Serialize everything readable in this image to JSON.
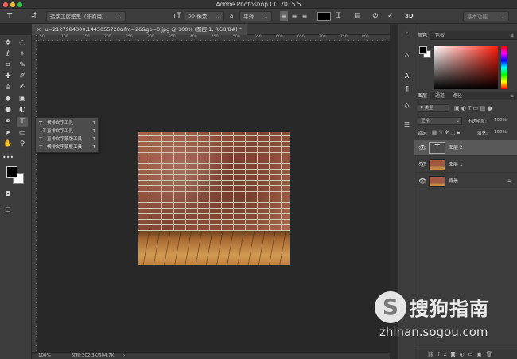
{
  "app": {
    "title": "Adobe Photoshop CC 2015.5"
  },
  "options_bar": {
    "tool_icon": "type-tool-icon",
    "orientation_icon": "text-orientation-icon",
    "font_family": "造字工房坚黑（非商用）",
    "size_icon": "font-size-icon",
    "font_size": "22 像素",
    "aa_prefix": "a",
    "aa_mode": "平滑",
    "text_color": "#000000",
    "workspace": "基本功能"
  },
  "document": {
    "tab_title": "u=2127984300,1445055728&fm=26&gp=0.jpg @ 100% (图层 1, RGB/8#) *",
    "ruler_numbers": [
      "50",
      "100",
      "150",
      "200",
      "250",
      "300",
      "350",
      "400",
      "450",
      "500",
      "550",
      "600",
      "650",
      "700",
      "750",
      "800"
    ]
  },
  "flyout": {
    "items": [
      {
        "icon": "T",
        "label": "横排文字工具",
        "shortcut": "T"
      },
      {
        "icon": "↓T",
        "label": "直排文字工具",
        "shortcut": "T"
      },
      {
        "icon": "T",
        "label": "直排文字蒙版工具",
        "shortcut": "T"
      },
      {
        "icon": "T",
        "label": "横排文字蒙版工具",
        "shortcut": "T"
      }
    ]
  },
  "statusbar": {
    "zoom": "100%",
    "doc_size": "文档:302.3K/604.7K"
  },
  "color_panel": {
    "tabs": [
      "颜色",
      "色板"
    ],
    "foreground": "#000000",
    "background": "#ffffff"
  },
  "layers_panel": {
    "tabs": [
      "图层",
      "通道",
      "路径"
    ],
    "kind_filter": "类型",
    "blend_mode": "正常",
    "opacity_label": "不透明度:",
    "opacity": "100%",
    "lock_label": "锁定:",
    "fill_label": "填充:",
    "fill": "100%",
    "layers": [
      {
        "name": "图层 2",
        "type": "text"
      },
      {
        "name": "图层 1",
        "type": "image"
      },
      {
        "name": "背景",
        "type": "image",
        "locked": true
      }
    ]
  },
  "watermark": {
    "cn": "搜狗指南",
    "url": "zhinan.sogou.com"
  }
}
